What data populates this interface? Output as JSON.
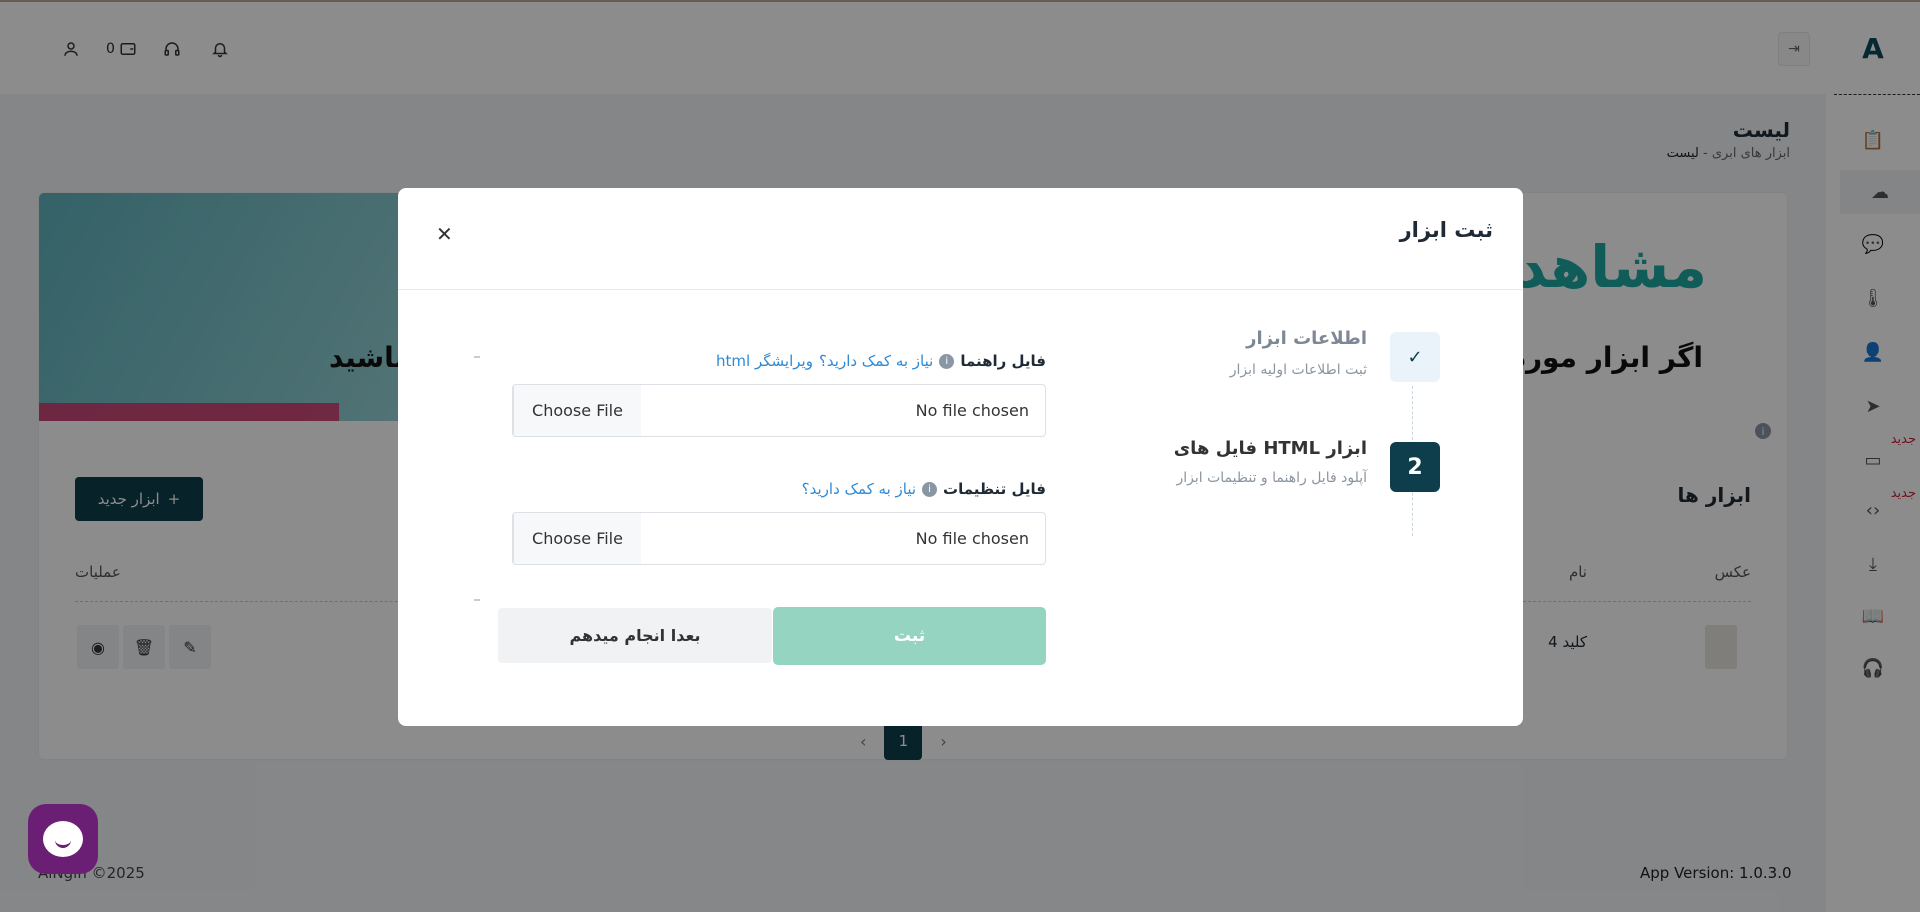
{
  "topbar": {
    "wallet_count": "0"
  },
  "sidebar": {
    "logo": "A",
    "new_badge": "جدید"
  },
  "page": {
    "title": "لیست",
    "breadcrumb_parent": "ابزار های ابری",
    "breadcrumb_sep": "-",
    "breadcrumb_current": "لیست"
  },
  "banner": {
    "brand": "مشاهد",
    "tagline_right": "اگر ابزار مورد ن",
    "tagline_left": "باشید"
  },
  "tools": {
    "title": "ابزار ها",
    "new_button": "ابزار جدید",
    "columns": {
      "image": "عکس",
      "name": "نام",
      "actions": "عملیات"
    },
    "rows": [
      {
        "name": "کلید 4"
      }
    ],
    "page": "1"
  },
  "footer": {
    "copyright": "AlNgin ©2025",
    "version": "App Version: 1.0.3.0"
  },
  "modal": {
    "title": "ثبت ابزار",
    "steps": [
      {
        "title": "اطلاعات ابزار",
        "subtitle": "ثبت اطلاعات اولیه ابزار",
        "badge": "✓"
      },
      {
        "title": "فایل های HTML ابزار",
        "subtitle": "آپلود فایل راهنما و تنظیمات ابزار",
        "badge": "2"
      }
    ],
    "guide_field": {
      "label": "فایل راهنما",
      "help": "نیاز به کمک دارید؟",
      "editor": "ویرایشگر html",
      "button": "Choose File",
      "value": "No file chosen"
    },
    "settings_field": {
      "label": "فایل تنظیمات",
      "help": "نیاز به کمک دارید؟",
      "button": "Choose File",
      "value": "No file chosen"
    },
    "submit": "ثبت",
    "later": "بعدا انجام میدهم"
  }
}
